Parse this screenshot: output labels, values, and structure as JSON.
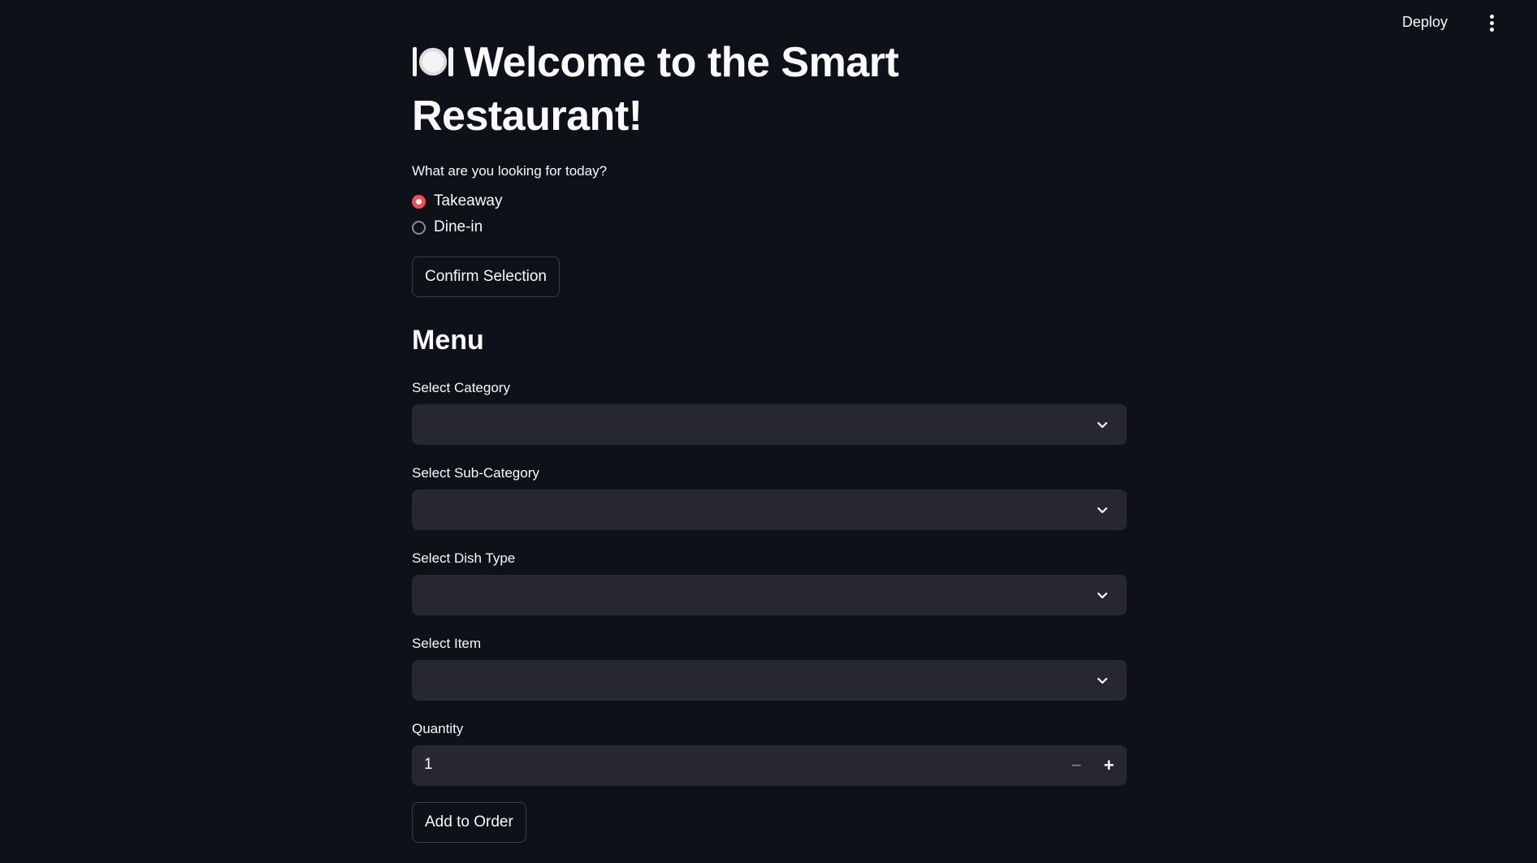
{
  "topbar": {
    "deploy_label": "Deploy",
    "menu_icon": "kebab-menu-icon"
  },
  "header": {
    "icon": "plate-cutlery-icon",
    "title": "Welcome to the Smart Restaurant!"
  },
  "order_type": {
    "question": "What are you looking for today?",
    "options": [
      {
        "label": "Takeaway",
        "selected": true
      },
      {
        "label": "Dine-in",
        "selected": false
      }
    ],
    "confirm_label": "Confirm Selection"
  },
  "menu": {
    "heading": "Menu",
    "selects": [
      {
        "label": "Select Category",
        "value": ""
      },
      {
        "label": "Select Sub-Category",
        "value": ""
      },
      {
        "label": "Select Dish Type",
        "value": ""
      },
      {
        "label": "Select Item",
        "value": ""
      }
    ],
    "quantity": {
      "label": "Quantity",
      "value": "1",
      "minus": "−",
      "plus": "+"
    },
    "add_label": "Add to Order"
  },
  "colors": {
    "background": "#0e1117",
    "input_bg": "#262730",
    "accent": "#ff4b4b",
    "text": "#fafafa"
  }
}
